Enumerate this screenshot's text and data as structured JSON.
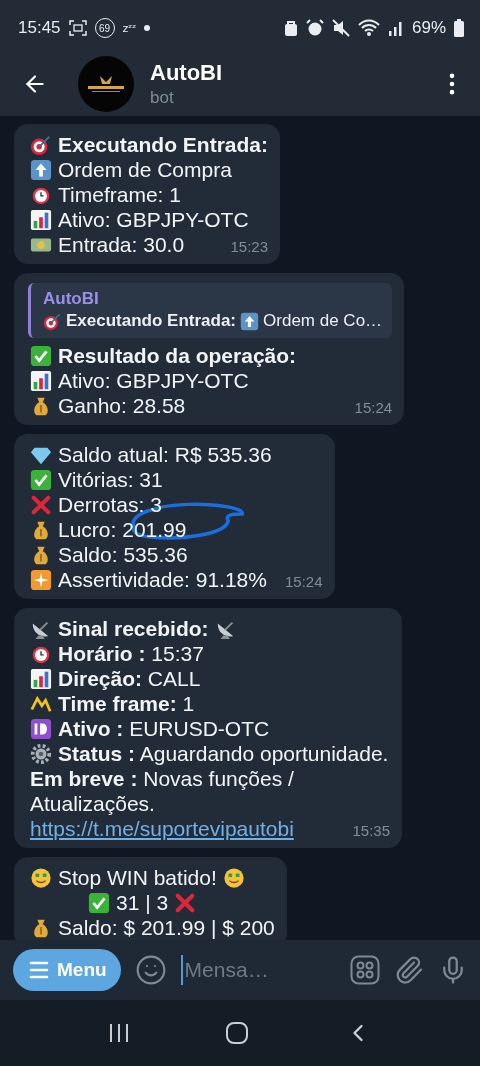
{
  "status_bar": {
    "time": "15:45",
    "badge": "69",
    "sleep": "zᶻᶻ",
    "battery": "69%"
  },
  "header": {
    "title": "AutoBI",
    "subtitle": "bot"
  },
  "messages": [
    {
      "lines": [
        "**Executando Entrada:**",
        "Ordem de Compra",
        "Timeframe: 1",
        "Ativo: GBPJPY-OTC",
        "Entrada: 30.0"
      ],
      "time": "15:23",
      "scribbled": false
    },
    {
      "reply": {
        "author": "AutoBI",
        "parts": [
          "Executando Entrada:",
          "Ordem de Co…"
        ]
      },
      "lines": [
        "**Resultado da operação:**",
        "Ativo: GBPJPY-OTC",
        "Ganho: 28.58"
      ],
      "time": "15:24",
      "scribbled": false
    },
    {
      "lines": [
        "Saldo atual:  R$ 535.36",
        "Vitórias: 31",
        "Derrotas: 3",
        "Lucro: 201.99",
        "Saldo: 535.36",
        "Assertividade: 91.18%"
      ],
      "time": "15:24",
      "scribbled": true
    },
    {
      "lines": [
        "**Sinal recebido:**",
        "**Horário :** 15:37",
        "**Direção:** CALL",
        "**Time frame:** 1",
        "**Ativo :** EURUSD-OTC",
        "**Status :** Aguardando oportunidade."
      ],
      "note": "**Em breve :** Novas funções / Atualizações.",
      "link": "https://t.me/suportevipautobi",
      "time": "15:35",
      "scribbled": false
    },
    {
      "lines": [
        "Stop WIN batido!",
        "31 | 3",
        "Saldo: $ 201.99 | $ 200"
      ],
      "scribbled": false
    }
  ],
  "composer": {
    "menu_label": "Menu",
    "placeholder": "Mensa…"
  }
}
